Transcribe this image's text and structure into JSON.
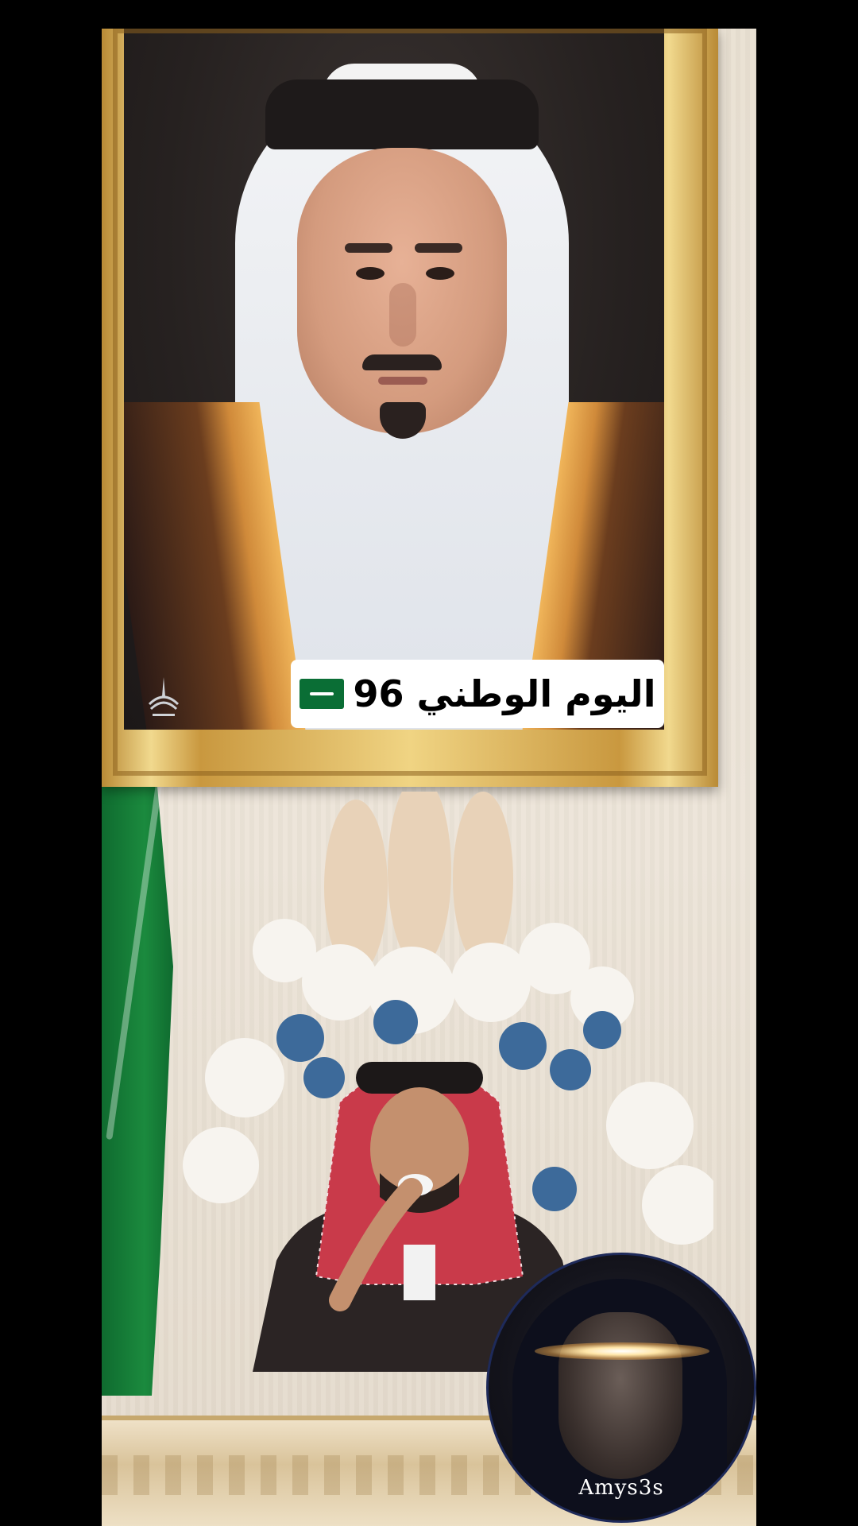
{
  "caption": {
    "text": "اليوم الوطني 96",
    "flag_icon": "saudi-flag-icon"
  },
  "avatar": {
    "label": "Amys3s"
  },
  "colors": {
    "frame_gold": "#d7b05a",
    "flag_green": "#1b8a3e",
    "background": "#000000"
  }
}
